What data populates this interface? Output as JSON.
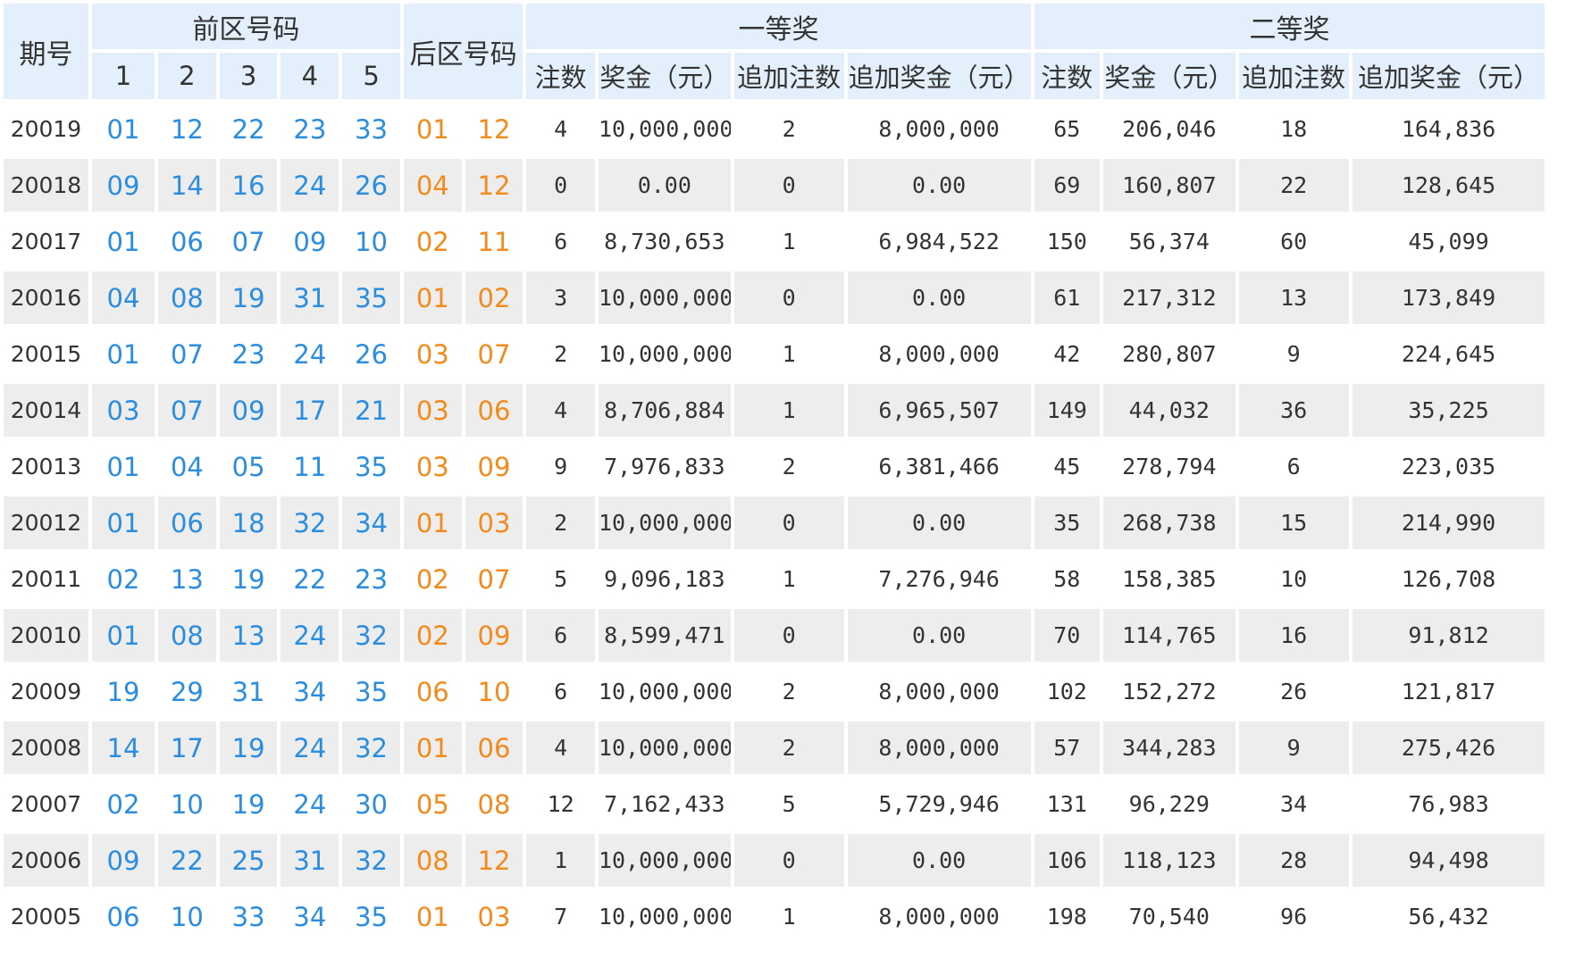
{
  "header": {
    "period": "期号",
    "front_zone": "前区号码",
    "back_zone": "后区号码",
    "first_prize": "一等奖",
    "second_prize": "二等奖",
    "front_cols": [
      "1",
      "2",
      "3",
      "4",
      "5"
    ],
    "first_cols": [
      "注数",
      "奖金（元）",
      "追加注数",
      "追加奖金（元）"
    ],
    "second_cols": [
      "注数",
      "奖金（元）",
      "追加注数",
      "追加奖金（元）"
    ]
  },
  "colors": {
    "front": "#2b8de0",
    "back": "#f28a1c",
    "header_bg": "#e3effb",
    "stripe_bg": "#ededed"
  },
  "rows": [
    {
      "period": "20019",
      "front": [
        "01",
        "12",
        "22",
        "23",
        "33"
      ],
      "back": [
        "01",
        "12"
      ],
      "p1": {
        "count": "4",
        "amount": "10,000,000",
        "add_count": "2",
        "add_amount": "8,000,000"
      },
      "p2": {
        "count": "65",
        "amount": "206,046",
        "add_count": "18",
        "add_amount": "164,836"
      }
    },
    {
      "period": "20018",
      "front": [
        "09",
        "14",
        "16",
        "24",
        "26"
      ],
      "back": [
        "04",
        "12"
      ],
      "p1": {
        "count": "0",
        "amount": "0.00",
        "add_count": "0",
        "add_amount": "0.00"
      },
      "p2": {
        "count": "69",
        "amount": "160,807",
        "add_count": "22",
        "add_amount": "128,645"
      }
    },
    {
      "period": "20017",
      "front": [
        "01",
        "06",
        "07",
        "09",
        "10"
      ],
      "back": [
        "02",
        "11"
      ],
      "p1": {
        "count": "6",
        "amount": "8,730,653",
        "add_count": "1",
        "add_amount": "6,984,522"
      },
      "p2": {
        "count": "150",
        "amount": "56,374",
        "add_count": "60",
        "add_amount": "45,099"
      }
    },
    {
      "period": "20016",
      "front": [
        "04",
        "08",
        "19",
        "31",
        "35"
      ],
      "back": [
        "01",
        "02"
      ],
      "p1": {
        "count": "3",
        "amount": "10,000,000",
        "add_count": "0",
        "add_amount": "0.00"
      },
      "p2": {
        "count": "61",
        "amount": "217,312",
        "add_count": "13",
        "add_amount": "173,849"
      }
    },
    {
      "period": "20015",
      "front": [
        "01",
        "07",
        "23",
        "24",
        "26"
      ],
      "back": [
        "03",
        "07"
      ],
      "p1": {
        "count": "2",
        "amount": "10,000,000",
        "add_count": "1",
        "add_amount": "8,000,000"
      },
      "p2": {
        "count": "42",
        "amount": "280,807",
        "add_count": "9",
        "add_amount": "224,645"
      }
    },
    {
      "period": "20014",
      "front": [
        "03",
        "07",
        "09",
        "17",
        "21"
      ],
      "back": [
        "03",
        "06"
      ],
      "p1": {
        "count": "4",
        "amount": "8,706,884",
        "add_count": "1",
        "add_amount": "6,965,507"
      },
      "p2": {
        "count": "149",
        "amount": "44,032",
        "add_count": "36",
        "add_amount": "35,225"
      }
    },
    {
      "period": "20013",
      "front": [
        "01",
        "04",
        "05",
        "11",
        "35"
      ],
      "back": [
        "03",
        "09"
      ],
      "p1": {
        "count": "9",
        "amount": "7,976,833",
        "add_count": "2",
        "add_amount": "6,381,466"
      },
      "p2": {
        "count": "45",
        "amount": "278,794",
        "add_count": "6",
        "add_amount": "223,035"
      }
    },
    {
      "period": "20012",
      "front": [
        "01",
        "06",
        "18",
        "32",
        "34"
      ],
      "back": [
        "01",
        "03"
      ],
      "p1": {
        "count": "2",
        "amount": "10,000,000",
        "add_count": "0",
        "add_amount": "0.00"
      },
      "p2": {
        "count": "35",
        "amount": "268,738",
        "add_count": "15",
        "add_amount": "214,990"
      }
    },
    {
      "period": "20011",
      "front": [
        "02",
        "13",
        "19",
        "22",
        "23"
      ],
      "back": [
        "02",
        "07"
      ],
      "p1": {
        "count": "5",
        "amount": "9,096,183",
        "add_count": "1",
        "add_amount": "7,276,946"
      },
      "p2": {
        "count": "58",
        "amount": "158,385",
        "add_count": "10",
        "add_amount": "126,708"
      }
    },
    {
      "period": "20010",
      "front": [
        "01",
        "08",
        "13",
        "24",
        "32"
      ],
      "back": [
        "02",
        "09"
      ],
      "p1": {
        "count": "6",
        "amount": "8,599,471",
        "add_count": "0",
        "add_amount": "0.00"
      },
      "p2": {
        "count": "70",
        "amount": "114,765",
        "add_count": "16",
        "add_amount": "91,812"
      }
    },
    {
      "period": "20009",
      "front": [
        "19",
        "29",
        "31",
        "34",
        "35"
      ],
      "back": [
        "06",
        "10"
      ],
      "p1": {
        "count": "6",
        "amount": "10,000,000",
        "add_count": "2",
        "add_amount": "8,000,000"
      },
      "p2": {
        "count": "102",
        "amount": "152,272",
        "add_count": "26",
        "add_amount": "121,817"
      }
    },
    {
      "period": "20008",
      "front": [
        "14",
        "17",
        "19",
        "24",
        "32"
      ],
      "back": [
        "01",
        "06"
      ],
      "p1": {
        "count": "4",
        "amount": "10,000,000",
        "add_count": "2",
        "add_amount": "8,000,000"
      },
      "p2": {
        "count": "57",
        "amount": "344,283",
        "add_count": "9",
        "add_amount": "275,426"
      }
    },
    {
      "period": "20007",
      "front": [
        "02",
        "10",
        "19",
        "24",
        "30"
      ],
      "back": [
        "05",
        "08"
      ],
      "p1": {
        "count": "12",
        "amount": "7,162,433",
        "add_count": "5",
        "add_amount": "5,729,946"
      },
      "p2": {
        "count": "131",
        "amount": "96,229",
        "add_count": "34",
        "add_amount": "76,983"
      }
    },
    {
      "period": "20006",
      "front": [
        "09",
        "22",
        "25",
        "31",
        "32"
      ],
      "back": [
        "08",
        "12"
      ],
      "p1": {
        "count": "1",
        "amount": "10,000,000",
        "add_count": "0",
        "add_amount": "0.00"
      },
      "p2": {
        "count": "106",
        "amount": "118,123",
        "add_count": "28",
        "add_amount": "94,498"
      }
    },
    {
      "period": "20005",
      "front": [
        "06",
        "10",
        "33",
        "34",
        "35"
      ],
      "back": [
        "01",
        "03"
      ],
      "p1": {
        "count": "7",
        "amount": "10,000,000",
        "add_count": "1",
        "add_amount": "8,000,000"
      },
      "p2": {
        "count": "198",
        "amount": "70,540",
        "add_count": "96",
        "add_amount": "56,432"
      }
    }
  ]
}
